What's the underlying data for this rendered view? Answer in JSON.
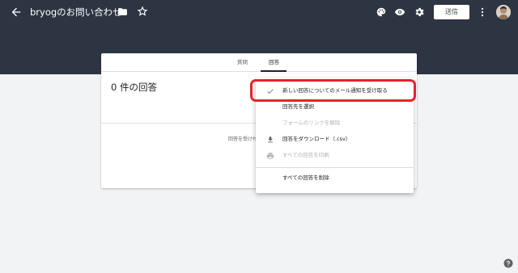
{
  "header": {
    "title": "bryogのお問い合わせ",
    "send_label": "送信",
    "icons": [
      "back-icon",
      "folder-icon",
      "star-icon",
      "palette-icon",
      "eye-icon",
      "gear-icon",
      "more-vert-icon",
      "avatar"
    ]
  },
  "tabs": [
    {
      "label": "質問",
      "active": false
    },
    {
      "label": "回答",
      "active": true
    }
  ],
  "responses": {
    "count_text": "0 件の回答",
    "accepting_text": "回答を受け付"
  },
  "menu": {
    "items": [
      {
        "label": "新しい回答についてのメール通知を受け取る",
        "icon": "check-icon",
        "disabled": false,
        "highlighted": true
      },
      {
        "label": "回答先を選択",
        "icon": "",
        "disabled": false
      },
      {
        "label": "フォームのリンクを解除",
        "icon": "",
        "disabled": true
      },
      {
        "label": "回答をダウンロード（.csv）",
        "icon": "download-icon",
        "disabled": false
      },
      {
        "label": "すべての回答を印刷",
        "icon": "print-icon",
        "disabled": true
      },
      {
        "label": "すべての回答を削除",
        "icon": "",
        "disabled": false
      }
    ]
  },
  "colors": {
    "header_bg": "#2d3442",
    "page_bg": "#f1f3f4",
    "highlight": "#e3242b"
  }
}
